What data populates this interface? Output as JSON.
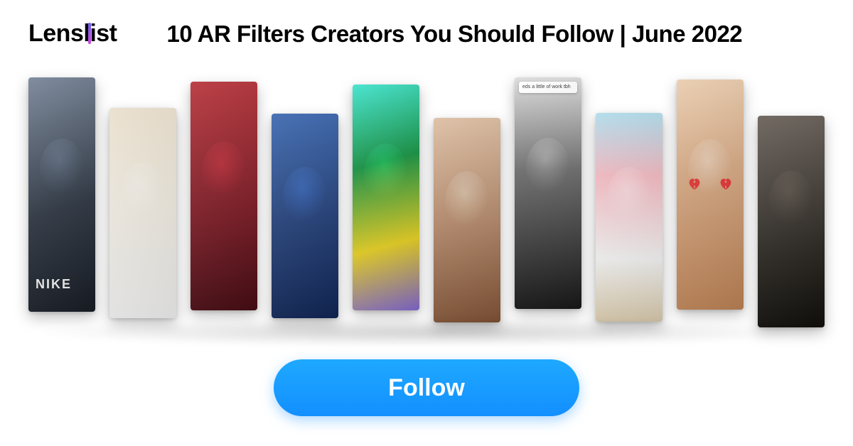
{
  "logo": {
    "text_part1": "Lens",
    "text_part2": "ist"
  },
  "headline": "10 AR Filters Creators You Should Follow | June 2022",
  "cards": [
    {
      "name": "creator-1",
      "overlay_text": "NIKE"
    },
    {
      "name": "creator-2"
    },
    {
      "name": "creator-3"
    },
    {
      "name": "creator-4"
    },
    {
      "name": "creator-5"
    },
    {
      "name": "creator-6"
    },
    {
      "name": "creator-7",
      "note_text": "eds a little of work tbh"
    },
    {
      "name": "creator-8"
    },
    {
      "name": "creator-9",
      "heart_icon": "broken-heart-icon"
    },
    {
      "name": "creator-10"
    }
  ],
  "button": {
    "follow_label": "Follow"
  },
  "colors": {
    "button_bg": "#138fff",
    "logo_gradient_start": "#6b5ee6",
    "logo_gradient_end": "#c94bd9"
  }
}
